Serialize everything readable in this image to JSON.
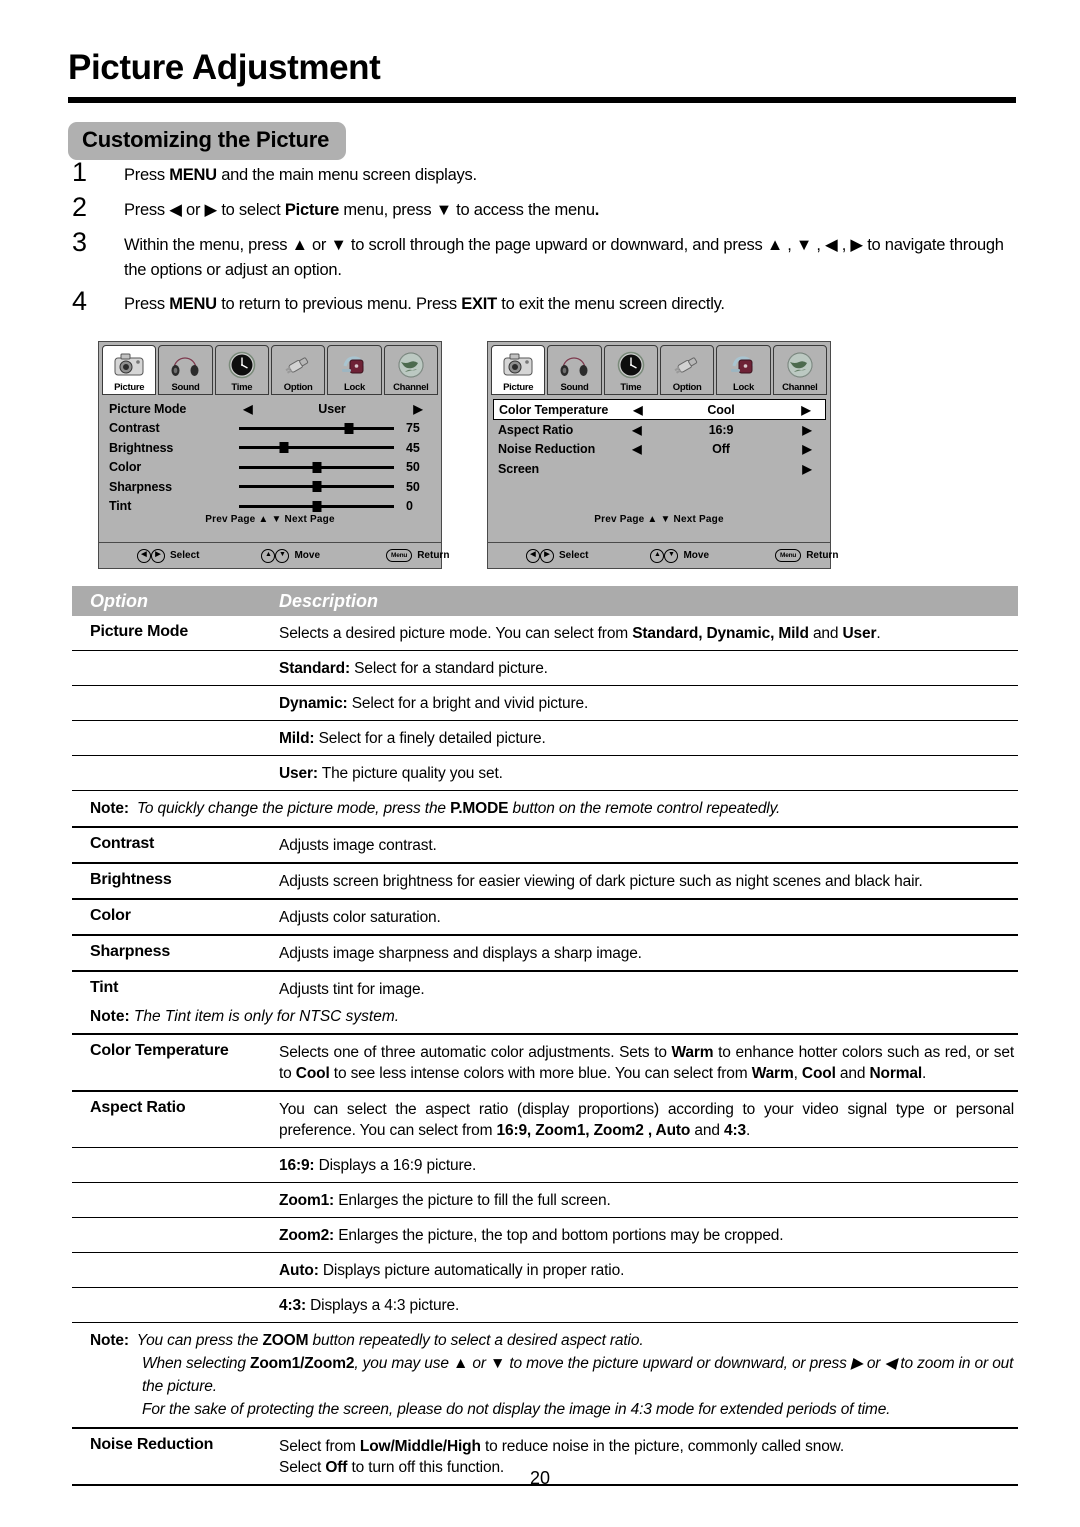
{
  "document": {
    "title": "Picture Adjustment",
    "section_heading": "Customizing the Picture",
    "page_number": "20"
  },
  "steps": [
    {
      "num": "1",
      "parts": [
        {
          "t": "Press ",
          "b": false
        },
        {
          "t": "MENU",
          "b": true
        },
        {
          "t": " and the main menu screen displays.",
          "b": false
        }
      ]
    },
    {
      "num": "2",
      "parts": [
        {
          "t": "Press ",
          "b": false
        },
        {
          "t": "◀",
          "b": false
        },
        {
          "t": " or ",
          "b": false
        },
        {
          "t": "▶",
          "b": false
        },
        {
          "t": " to select ",
          "b": false
        },
        {
          "t": "Picture",
          "b": true
        },
        {
          "t": " menu,  press ",
          "b": false
        },
        {
          "t": "▼",
          "b": false
        },
        {
          "t": " to access the menu",
          "b": false
        },
        {
          "t": ".",
          "b": true
        }
      ]
    },
    {
      "num": "3",
      "parts": [
        {
          "t": "Within the menu, press ",
          "b": false
        },
        {
          "t": "▲",
          "b": false
        },
        {
          "t": " or ",
          "b": false
        },
        {
          "t": "▼",
          "b": false
        },
        {
          "t": " to scroll through the page upward or downward, and press ",
          "b": false
        },
        {
          "t": "▲",
          "b": false
        },
        {
          "t": " , ",
          "b": false
        },
        {
          "t": "▼",
          "b": false
        },
        {
          "t": " , ",
          "b": false
        },
        {
          "t": "◀",
          "b": false
        },
        {
          "t": " , ",
          "b": false
        },
        {
          "t": "▶",
          "b": false
        },
        {
          "t": " to navigate through the options or adjust an option.",
          "b": false
        }
      ]
    },
    {
      "num": "4",
      "parts": [
        {
          "t": "Press ",
          "b": false
        },
        {
          "t": "MENU",
          "b": true
        },
        {
          "t": " to return to previous menu. Press ",
          "b": false
        },
        {
          "t": "EXIT",
          "b": true
        },
        {
          "t": " to exit the menu screen directly.",
          "b": false
        }
      ]
    }
  ],
  "osd": {
    "tabs": [
      {
        "label": "Picture",
        "icon": "camera-icon",
        "active": true
      },
      {
        "label": "Sound",
        "icon": "headphones-icon",
        "active": false
      },
      {
        "label": "Time",
        "icon": "clock-icon",
        "active": false
      },
      {
        "label": "Option",
        "icon": "plug-icon",
        "active": false
      },
      {
        "label": "Lock",
        "icon": "padlock-icon",
        "active": false
      },
      {
        "label": "Channel",
        "icon": "globe-icon",
        "active": false
      }
    ],
    "paging": "Prev  Page ▲   ▼ Next  Page",
    "footer": [
      {
        "keys": "◀▶",
        "label": "Select"
      },
      {
        "keys": "▲▼",
        "label": "Move"
      },
      {
        "keys": "Menu",
        "label": "Return"
      }
    ],
    "page1": {
      "rows": [
        {
          "type": "select",
          "label": "Picture Mode",
          "value": "User"
        },
        {
          "type": "slider",
          "label": "Contrast",
          "value": "75",
          "pct": 71
        },
        {
          "type": "slider",
          "label": "Brightness",
          "value": "45",
          "pct": 29
        },
        {
          "type": "slider",
          "label": "Color",
          "value": "50",
          "pct": 50
        },
        {
          "type": "slider",
          "label": "Sharpness",
          "value": "50",
          "pct": 50
        },
        {
          "type": "slider",
          "label": "Tint",
          "value": "0",
          "pct": 50
        }
      ]
    },
    "page2": {
      "rows": [
        {
          "type": "select",
          "label": "Color Temperature",
          "value": "Cool",
          "highlight": true
        },
        {
          "type": "select",
          "label": "Aspect Ratio",
          "value": "16:9",
          "highlight": false
        },
        {
          "type": "select",
          "label": "Noise Reduction",
          "value": "Off",
          "highlight": false
        },
        {
          "type": "submenu",
          "label": "Screen",
          "value": "",
          "highlight": false
        }
      ]
    }
  },
  "table": {
    "headers": {
      "option": "Option",
      "description": "Description"
    },
    "rows": [
      {
        "option": "Picture Mode",
        "desc_parts": [
          {
            "t": "Selects a desired picture mode. You can select from ",
            "b": false
          },
          {
            "t": "Standard, Dynamic, Mild",
            "b": true
          },
          {
            "t": " and ",
            "b": false
          },
          {
            "t": "User",
            "b": true
          },
          {
            "t": ".",
            "b": false
          }
        ]
      },
      {
        "option": "",
        "desc_parts": [
          {
            "t": "Standard:",
            "b": true
          },
          {
            "t": " Select for a standard picture.",
            "b": false
          }
        ]
      },
      {
        "option": "",
        "desc_parts": [
          {
            "t": "Dynamic:",
            "b": true
          },
          {
            "t": " Select for a bright and vivid picture.",
            "b": false
          }
        ]
      },
      {
        "option": "",
        "desc_parts": [
          {
            "t": "Mild:",
            "b": true
          },
          {
            "t": " Select for a finely detailed picture.",
            "b": false
          }
        ]
      },
      {
        "option": "",
        "desc_parts": [
          {
            "t": "User:",
            "b": true
          },
          {
            "t": " The picture quality you set.",
            "b": false
          }
        ]
      }
    ],
    "note_pmode": {
      "label": "Note:",
      "parts": [
        {
          "t": " To quickly change the picture mode, press the ",
          "b": false
        },
        {
          "t": "P.MODE",
          "b": true
        },
        {
          "t": " button on the remote control repeatedly.",
          "b": false
        }
      ]
    },
    "simple_rows": [
      {
        "option": "Contrast",
        "desc": "Adjusts image contrast."
      },
      {
        "option": "Brightness",
        "desc": "Adjusts screen brightness for easier viewing of dark picture such as night scenes and black hair."
      },
      {
        "option": "Color",
        "desc": "Adjusts color saturation."
      },
      {
        "option": "Sharpness",
        "desc": "Adjusts image sharpness and displays a sharp image."
      }
    ],
    "tint_row": {
      "option": "Tint",
      "desc": "Adjusts tint for image."
    },
    "note_tint": {
      "label": "Note:",
      "text": " The Tint item is only for NTSC system."
    },
    "color_temp": {
      "option": "Color Temperature",
      "desc_parts": [
        {
          "t": "Selects one of three automatic color adjustments.  Sets to ",
          "b": false
        },
        {
          "t": "Warm",
          "b": true
        },
        {
          "t": " to enhance hotter colors such as red,  or set to ",
          "b": false
        },
        {
          "t": "Cool",
          "b": true
        },
        {
          "t": " to see less intense colors with more blue.  You can select from ",
          "b": false
        },
        {
          "t": "Warm",
          "b": true
        },
        {
          "t": ", ",
          "b": false
        },
        {
          "t": "Cool",
          "b": true
        },
        {
          "t": " and ",
          "b": false
        },
        {
          "t": "Normal",
          "b": true
        },
        {
          "t": ".",
          "b": false
        }
      ]
    },
    "aspect_ratio": {
      "option": "Aspect Ratio",
      "desc_parts": [
        {
          "t": "You can select the aspect ratio (display proportions) according to your video signal type or personal preference. You can select from ",
          "b": false
        },
        {
          "t": "16:9,  Zoom1, Zoom2 , Auto",
          "b": true
        },
        {
          "t": " and ",
          "b": false
        },
        {
          "t": "4:3",
          "b": true
        },
        {
          "t": ".",
          "b": false
        }
      ]
    },
    "aspect_options": [
      {
        "option": "",
        "desc_parts": [
          {
            "t": "16:9:",
            "b": true
          },
          {
            "t": " Displays a 16:9 picture.",
            "b": false
          }
        ]
      },
      {
        "option": "",
        "desc_parts": [
          {
            "t": "Zoom1:",
            "b": true
          },
          {
            "t": " Enlarges the picture to fill the full screen.",
            "b": false
          }
        ]
      },
      {
        "option": "",
        "desc_parts": [
          {
            "t": "Zoom2:",
            "b": true
          },
          {
            "t": " Enlarges the picture, the top and bottom portions may be cropped.",
            "b": false
          }
        ]
      },
      {
        "option": "",
        "desc_parts": [
          {
            "t": "Auto:",
            "b": true
          },
          {
            "t": " Displays picture automatically in proper ratio.",
            "b": false
          }
        ]
      },
      {
        "option": "",
        "desc_parts": [
          {
            "t": "4:3:",
            "b": true
          },
          {
            "t": " Displays a 4:3 picture.",
            "b": false
          }
        ]
      }
    ],
    "note_zoom": {
      "label": "Note:",
      "lines": [
        [
          {
            "t": " You can press the ",
            "b": false
          },
          {
            "t": "ZOOM",
            "b": true
          },
          {
            "t": " button repeatedly to select a desired aspect ratio.",
            "b": false
          }
        ],
        [
          {
            "t": "When selecting ",
            "b": false
          },
          {
            "t": "Zoom1/Zoom2",
            "b": true
          },
          {
            "t": ", you may use ▲ or ▼ to move the picture upward or downward, or press ▶ or ◀ to zoom in or out the picture.",
            "b": false
          }
        ],
        [
          {
            "t": "For the sake of protecting the screen, please do not display the image in 4:3 mode for extended periods of time.",
            "b": false
          }
        ]
      ]
    },
    "noise_reduction": {
      "option": "Noise Reduction",
      "desc_parts": [
        {
          "t": "Select from ",
          "b": false
        },
        {
          "t": "Low/Middle/High",
          "b": true
        },
        {
          "t": " to reduce noise in the picture, commonly called snow.",
          "b": false
        },
        {
          "t": "\n",
          "b": false
        },
        {
          "t": "Select ",
          "b": false
        },
        {
          "t": "Off",
          "b": true
        },
        {
          "t": " to turn off this function.",
          "b": false
        }
      ]
    }
  },
  "colors": {
    "badge_bg": "#b0b0b0",
    "table_head_bg": "#ababab",
    "osd_bg": "#b3b3b3",
    "rule": "#000000"
  }
}
